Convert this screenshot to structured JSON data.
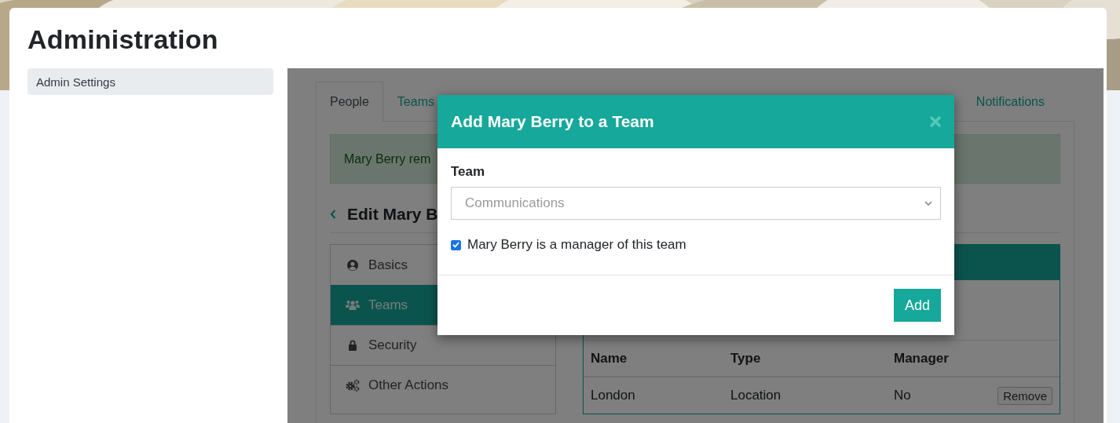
{
  "page": {
    "title": "Administration"
  },
  "sidebar": {
    "items": [
      {
        "label": "Admin Settings",
        "selected": true
      }
    ]
  },
  "tabs": [
    {
      "label": "People",
      "selected": true
    },
    {
      "label": "Teams",
      "selected": false
    },
    {
      "label": "Notifications",
      "selected": false
    }
  ],
  "alert": {
    "text": "Mary Berry rem"
  },
  "heading": {
    "text": "Edit Mary B"
  },
  "nav": [
    {
      "label": "Basics",
      "kind": "user",
      "selected": false
    },
    {
      "label": "Teams",
      "kind": "users",
      "selected": true
    },
    {
      "label": "Security",
      "kind": "lock",
      "selected": false
    },
    {
      "label": "Other Actions",
      "kind": "gears",
      "selected": false
    }
  ],
  "teams_table": {
    "columns": [
      "Name",
      "Type",
      "Manager"
    ],
    "rows": [
      {
        "cells": [
          "London",
          "Location",
          "No"
        ],
        "action": "Remove"
      }
    ]
  },
  "modal": {
    "title": "Add Mary Berry to a Team",
    "field_label": "Team",
    "select_value": "Communications",
    "checkbox": {
      "label": "Mary Berry is a manager of this team",
      "checked": true
    },
    "button": "Add"
  }
}
